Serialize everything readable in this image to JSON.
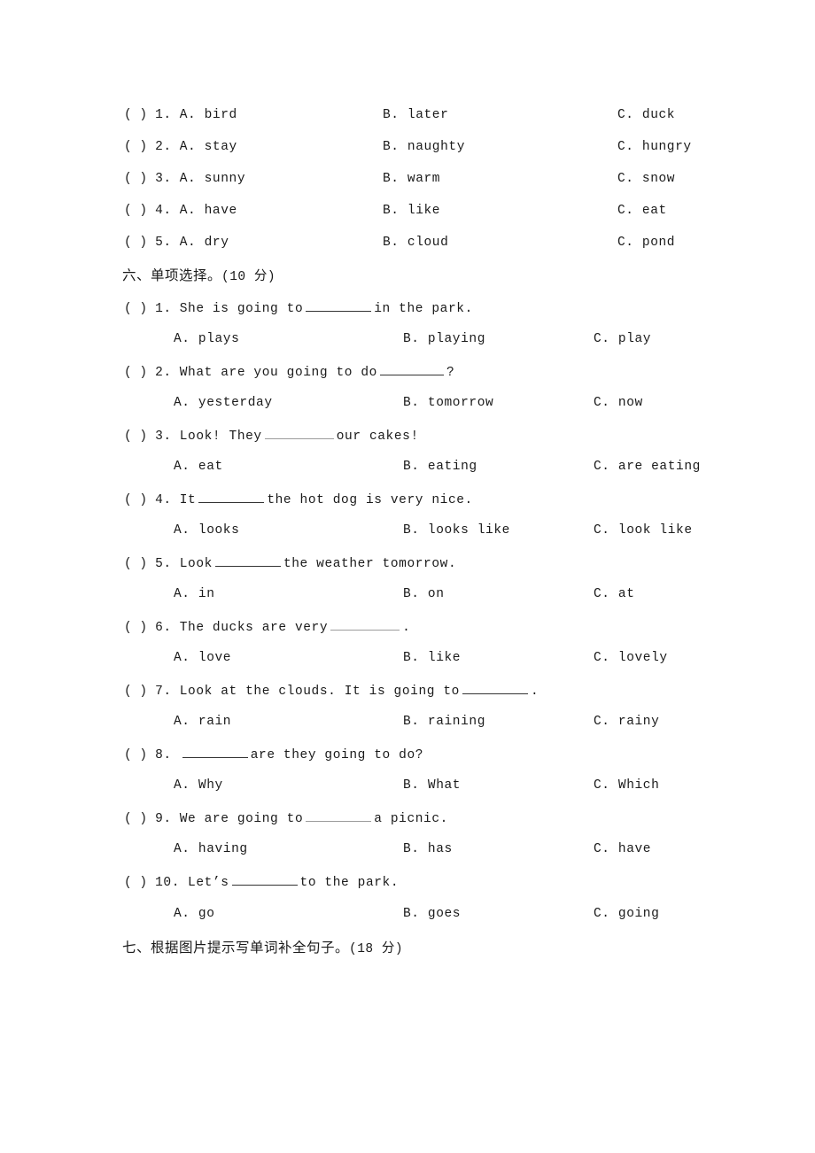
{
  "document": {
    "type": "english-exam-worksheet",
    "language": "zh-CN + en"
  },
  "section_five": {
    "questions": [
      {
        "marker": "(  )",
        "number": "1.",
        "a": "A.  bird",
        "b": "B.  later",
        "c": "C.  duck"
      },
      {
        "marker": "(  )",
        "number": "2.",
        "a": "A.  stay",
        "b": "B.  naughty",
        "c": "C.  hungry"
      },
      {
        "marker": "(  )",
        "number": "3.",
        "a": "A.  sunny",
        "b": "B.  warm",
        "c": "C.  snow"
      },
      {
        "marker": "(  )",
        "number": "4.",
        "a": "A.  have",
        "b": "B.  like",
        "c": "C.  eat"
      },
      {
        "marker": "(  )",
        "number": "5.",
        "a": "A.  dry",
        "b": "B.  cloud",
        "c": "C.  pond"
      }
    ]
  },
  "section_six": {
    "heading_text": "六、单项选择。",
    "heading_score": "(10 分)",
    "questions": [
      {
        "marker": "(  )",
        "number": "1.",
        "stem_before": "She is going to",
        "stem_after": "in the park.",
        "a": "A.  plays",
        "b": "B.  playing",
        "c": "C.  play"
      },
      {
        "marker": "(  )",
        "number": "2.",
        "stem_before": "What are you going to do",
        "stem_after": "?",
        "a": "A.  yesterday",
        "b": "B.  tomorrow",
        "c": "C.  now"
      },
      {
        "marker": "(  )",
        "number": "3.",
        "stem_before": "Look! They",
        "stem_after": "our cakes!",
        "a": "A.  eat",
        "b": "B.  eating",
        "c": "C.  are eating"
      },
      {
        "marker": "(  )",
        "number": "4.",
        "stem_before": "It",
        "stem_after": "the hot dog is very nice.",
        "a": "A.  looks",
        "b": "B.  looks like",
        "c": "C.  look like"
      },
      {
        "marker": "(  )",
        "number": "5.",
        "stem_before": "Look",
        "stem_after": "the weather tomorrow.",
        "a": "A.  in",
        "b": "B.  on",
        "c": "C.  at"
      },
      {
        "marker": "(  )",
        "number": "6.",
        "stem_before": "The ducks are very",
        "stem_after": ".",
        "a": "A.  love",
        "b": "B.  like",
        "c": "C.  lovely"
      },
      {
        "marker": "(  )",
        "number": "7.",
        "stem_before": "Look at the clouds. It is going to",
        "stem_after": ".",
        "a": "A.  rain",
        "b": "B.  raining",
        "c": "C.  rainy"
      },
      {
        "marker": "(  )",
        "number": "8.",
        "stem_before": "",
        "stem_after": "are they going to do?",
        "a": "A.  Why",
        "b": "B.  What",
        "c": "C.  Which"
      },
      {
        "marker": "(  )",
        "number": "9.",
        "stem_before": "We are going to",
        "stem_after": "a picnic.",
        "a": "A.  having",
        "b": "B.  has",
        "c": "C.  have"
      },
      {
        "marker": "(  )",
        "number": "10.",
        "stem_before": "Let’s",
        "stem_after": "to the park.",
        "a": "A.  go",
        "b": "B.  goes",
        "c": "C.  going"
      }
    ]
  },
  "section_seven": {
    "heading_text": "七、根据图片提示写单词补全句子。",
    "heading_score": "(18 分)"
  }
}
